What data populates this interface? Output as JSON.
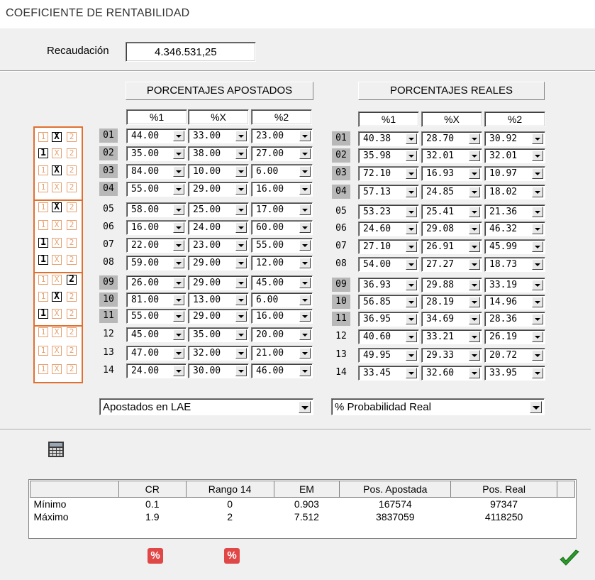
{
  "window": {
    "title": "COEFICIENTE DE RENTABILIDAD"
  },
  "recaudacion": {
    "label": "Recaudación",
    "value": "4.346.531,25"
  },
  "apostados": {
    "header": "PORCENTAJES APOSTADOS",
    "columns": [
      "%1",
      "%X",
      "%2"
    ],
    "rows": [
      [
        "44.00",
        "33.00",
        "23.00"
      ],
      [
        "35.00",
        "38.00",
        "27.00"
      ],
      [
        "84.00",
        "10.00",
        "6.00"
      ],
      [
        "55.00",
        "29.00",
        "16.00"
      ],
      [
        "58.00",
        "25.00",
        "17.00"
      ],
      [
        "16.00",
        "24.00",
        "60.00"
      ],
      [
        "22.00",
        "23.00",
        "55.00"
      ],
      [
        "59.00",
        "29.00",
        "12.00"
      ],
      [
        "26.00",
        "29.00",
        "45.00"
      ],
      [
        "81.00",
        "13.00",
        "6.00"
      ],
      [
        "55.00",
        "29.00",
        "16.00"
      ],
      [
        "45.00",
        "35.00",
        "20.00"
      ],
      [
        "47.00",
        "32.00",
        "21.00"
      ],
      [
        "24.00",
        "30.00",
        "46.00"
      ]
    ],
    "source_select": "Apostados en LAE"
  },
  "reales": {
    "header": "PORCENTAJES REALES",
    "columns": [
      "%1",
      "%X",
      "%2"
    ],
    "rows": [
      [
        "40.38",
        "28.70",
        "30.92"
      ],
      [
        "35.98",
        "32.01",
        "32.01"
      ],
      [
        "72.10",
        "16.93",
        "10.97"
      ],
      [
        "57.13",
        "24.85",
        "18.02"
      ],
      [
        "53.23",
        "25.41",
        "21.36"
      ],
      [
        "24.60",
        "29.08",
        "46.32"
      ],
      [
        "27.10",
        "26.91",
        "45.99"
      ],
      [
        "54.00",
        "27.27",
        "18.73"
      ],
      [
        "36.93",
        "29.88",
        "33.19"
      ],
      [
        "56.85",
        "28.19",
        "14.96"
      ],
      [
        "36.95",
        "34.69",
        "28.36"
      ],
      [
        "40.60",
        "33.21",
        "26.19"
      ],
      [
        "49.95",
        "29.33",
        "20.72"
      ],
      [
        "33.45",
        "32.60",
        "33.95"
      ]
    ],
    "source_select": "% Probabilidad Real"
  },
  "row_numbers": [
    "01",
    "02",
    "03",
    "04",
    "05",
    "06",
    "07",
    "08",
    "09",
    "10",
    "11",
    "12",
    "13",
    "14"
  ],
  "row_highlight": [
    true,
    true,
    true,
    true,
    false,
    false,
    false,
    false,
    true,
    true,
    true,
    false,
    false,
    false
  ],
  "slip": {
    "options": [
      "1",
      "X",
      "2"
    ],
    "selected": [
      "X",
      "1",
      "X",
      "",
      "X",
      "",
      "1",
      "1",
      "2",
      "X",
      "1",
      "",
      "",
      ""
    ]
  },
  "results": {
    "headers": [
      "",
      "CR",
      "Rango 14",
      "EM",
      "Pos. Apostada",
      "Pos. Real"
    ],
    "rows": [
      [
        "Mínimo",
        "0.1",
        "0",
        "0.903",
        "167574",
        "97347"
      ],
      [
        "Máximo",
        "1.9",
        "2",
        "7.512",
        "3837059",
        "4118250"
      ]
    ]
  },
  "buttons": {
    "pct_label": "%"
  },
  "icons": {
    "calculator": "calculator-icon",
    "accept": "checkmark-icon"
  },
  "colors": {
    "slip_border": "#e07030",
    "highlight_row": "#b8b8b8",
    "pct_button": "#e04848",
    "check": "#2a9a2a"
  }
}
